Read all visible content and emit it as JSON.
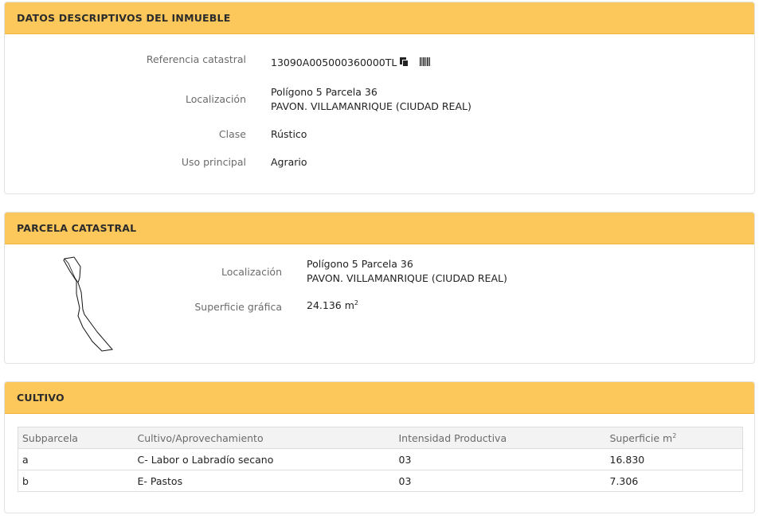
{
  "datos": {
    "header": "DATOS DESCRIPTIVOS DEL INMUEBLE",
    "referencia_label": "Referencia catastral",
    "referencia_value": "13090A005000360000TL",
    "localizacion_label": "Localización",
    "localizacion_line1": "Polígono 5 Parcela 36",
    "localizacion_line2": "PAVON. VILLAMANRIQUE (CIUDAD REAL)",
    "clase_label": "Clase",
    "clase_value": "Rústico",
    "uso_label": "Uso principal",
    "uso_value": "Agrario"
  },
  "parcela": {
    "header": "PARCELA CATASTRAL",
    "localizacion_label": "Localización",
    "localizacion_line1": "Polígono 5 Parcela 36",
    "localizacion_line2": "PAVON. VILLAMANRIQUE (CIUDAD REAL)",
    "superficie_label": "Superficie gráfica",
    "superficie_value": "24.136 m",
    "superficie_unit_sup": "2"
  },
  "cultivo": {
    "header": "CULTIVO",
    "columns": [
      "Subparcela",
      "Cultivo/Aprovechamiento",
      "Intensidad Productiva",
      "Superficie m"
    ],
    "superficie_col_sup": "2",
    "rows": [
      [
        "a",
        "C- Labor o Labradío secano",
        "03",
        "16.830"
      ],
      [
        "b",
        "E- Pastos",
        "03",
        "7.306"
      ]
    ]
  },
  "icons": {
    "copy": "copy-icon",
    "barcode": "barcode-icon"
  }
}
